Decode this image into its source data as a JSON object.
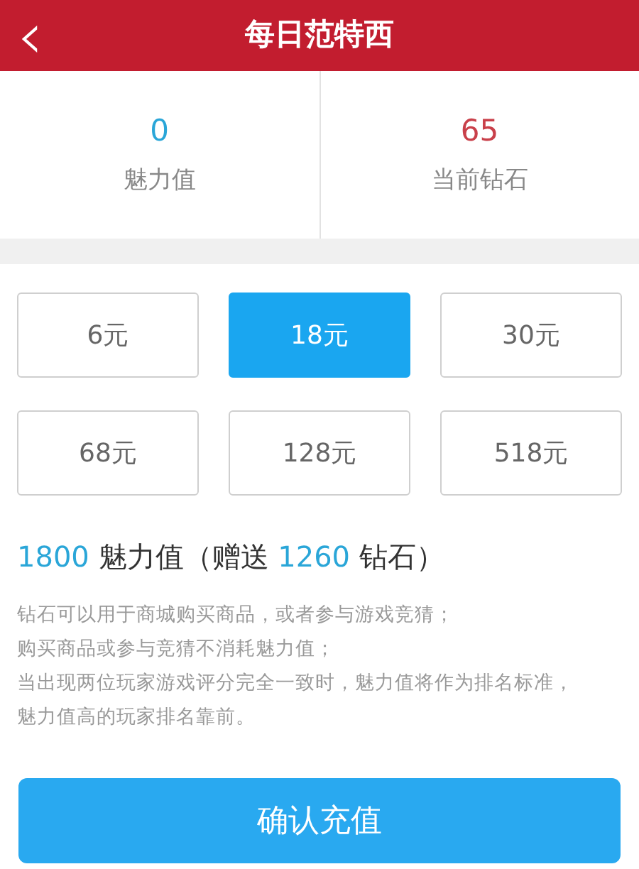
{
  "header": {
    "back": "‹",
    "title": "每日范特西"
  },
  "stats": [
    {
      "value": "0",
      "label": "魅力值",
      "color": "#2aa6d8"
    },
    {
      "value": "65",
      "label": "当前钻石",
      "color": "#c9404a"
    }
  ],
  "options": [
    {
      "label": "6元",
      "selected": false
    },
    {
      "label": "18元",
      "selected": true
    },
    {
      "label": "30元",
      "selected": false
    },
    {
      "label": "68元",
      "selected": false
    },
    {
      "label": "128元",
      "selected": false
    },
    {
      "label": "518元",
      "selected": false
    }
  ],
  "summary": {
    "amount": "1800",
    "unit": "魅力值（赠送",
    "bonus": "1260",
    "bonus_unit": "钻石）"
  },
  "notes": [
    "钻石可以用于商城购买商品，或者参与游戏竞猜；",
    "购买商品或参与竞猜不消耗魅力值；",
    "当出现两位玩家游戏评分完全一致时，魅力值将作为排名标准，魅力值高的玩家排名靠前。"
  ],
  "confirm_button": "确认充值"
}
